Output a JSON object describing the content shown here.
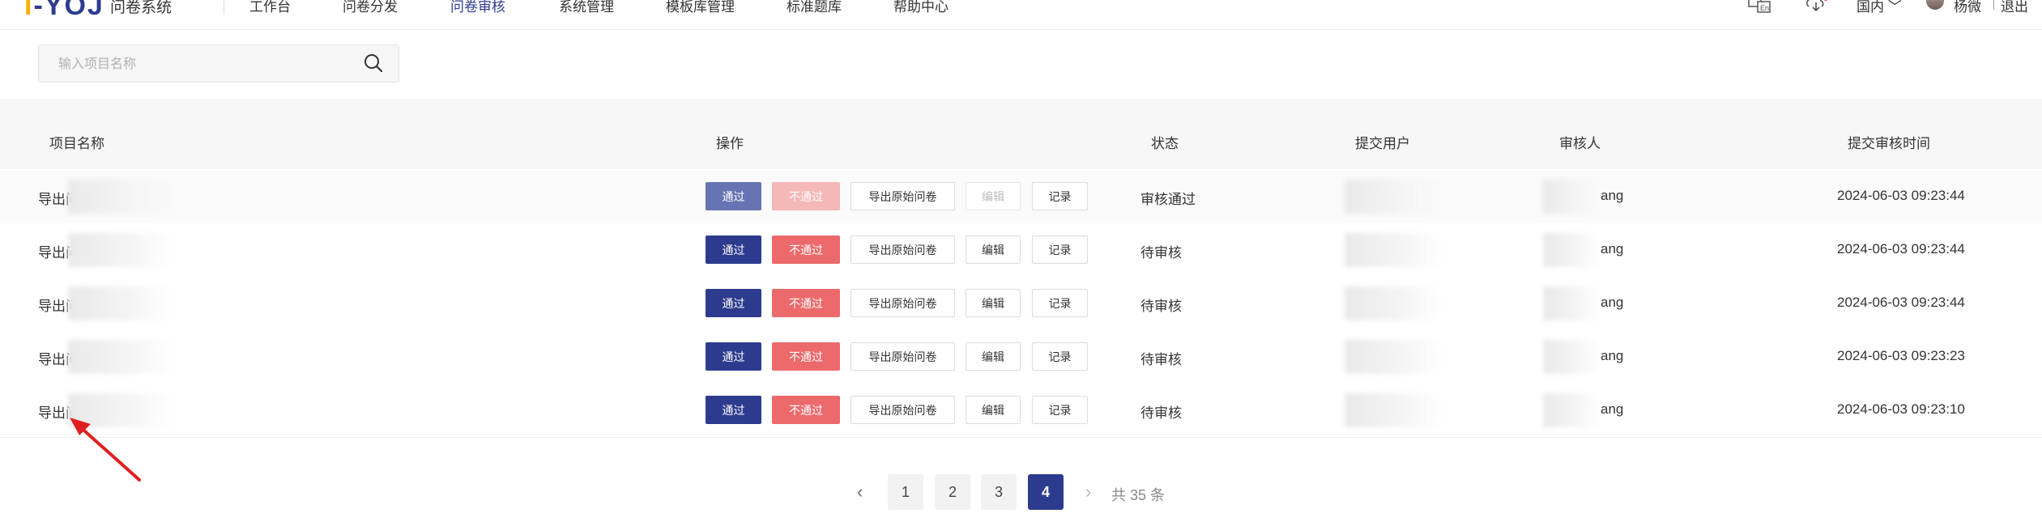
{
  "header": {
    "logo_text": "I-YOJ",
    "app_name": "问卷系统",
    "nav": [
      {
        "label": "工作台",
        "active": false
      },
      {
        "label": "问卷分发",
        "active": false
      },
      {
        "label": "问卷审核",
        "active": true
      },
      {
        "label": "系统管理",
        "active": false
      },
      {
        "label": "模板库管理",
        "active": false
      },
      {
        "label": "标准题库",
        "active": false
      },
      {
        "label": "帮助中心",
        "active": false
      }
    ],
    "language_icon": "translate-icon",
    "download_icon": "cloud-download-icon",
    "region": "国内",
    "username": "杨微",
    "logout": "退出"
  },
  "search": {
    "placeholder": "输入项目名称",
    "value": ""
  },
  "table": {
    "headers": [
      "项目名称",
      "操作",
      "状态",
      "提交用户",
      "审核人",
      "提交审核时间"
    ],
    "buttons": {
      "pass": "通过",
      "fail": "不通过",
      "export": "导出原始问卷",
      "edit": "编辑",
      "log": "记录"
    },
    "rows": [
      {
        "name": "导出问",
        "status": "审核通过",
        "submitter": "",
        "reviewer": "ang",
        "time": "2024-06-03 09:23:44",
        "state": "approved"
      },
      {
        "name": "导出问",
        "status": "待审核",
        "submitter": "",
        "reviewer": "ang",
        "time": "2024-06-03 09:23:44",
        "state": "pending"
      },
      {
        "name": "导出问",
        "status": "待审核",
        "submitter": "",
        "reviewer": "ang",
        "time": "2024-06-03 09:23:44",
        "state": "pending"
      },
      {
        "name": "导出问",
        "status": "待审核",
        "submitter": "",
        "reviewer": "ang",
        "time": "2024-06-03 09:23:23",
        "state": "pending"
      },
      {
        "name": "导出问",
        "status": "待审核",
        "submitter": "",
        "reviewer": "ang",
        "time": "2024-06-03 09:23:10",
        "state": "pending"
      }
    ]
  },
  "pagination": {
    "pages": [
      "1",
      "2",
      "3",
      "4"
    ],
    "current": "4",
    "total_text": "共 35 条"
  },
  "colors": {
    "primary": "#2d3b8f",
    "danger": "#ec6a6b",
    "annotation_arrow": "#e02020"
  }
}
